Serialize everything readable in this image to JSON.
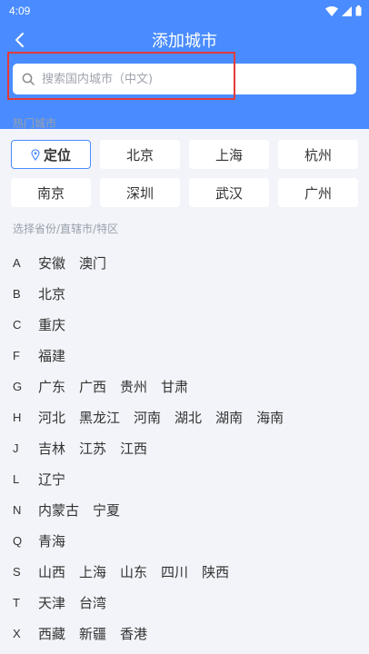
{
  "status": {
    "time": "4:09"
  },
  "header": {
    "title": "添加城市"
  },
  "search": {
    "placeholder": "搜索国内城市（中文)"
  },
  "hot": {
    "label": "热门城市",
    "locate_label": "定位",
    "cities": [
      "北京",
      "上海",
      "杭州",
      "南京",
      "深圳",
      "武汉",
      "广州"
    ]
  },
  "provinces_label": "选择省份/直辖市/特区",
  "provinces": [
    {
      "letter": "A",
      "items": [
        "安徽",
        "澳门"
      ]
    },
    {
      "letter": "B",
      "items": [
        "北京"
      ]
    },
    {
      "letter": "C",
      "items": [
        "重庆"
      ]
    },
    {
      "letter": "F",
      "items": [
        "福建"
      ]
    },
    {
      "letter": "G",
      "items": [
        "广东",
        "广西",
        "贵州",
        "甘肃"
      ]
    },
    {
      "letter": "H",
      "items": [
        "河北",
        "黑龙江",
        "河南",
        "湖北",
        "湖南",
        "海南"
      ]
    },
    {
      "letter": "J",
      "items": [
        "吉林",
        "江苏",
        "江西"
      ]
    },
    {
      "letter": "L",
      "items": [
        "辽宁"
      ]
    },
    {
      "letter": "N",
      "items": [
        "内蒙古",
        "宁夏"
      ]
    },
    {
      "letter": "Q",
      "items": [
        "青海"
      ]
    },
    {
      "letter": "S",
      "items": [
        "山西",
        "上海",
        "山东",
        "四川",
        "陕西"
      ]
    },
    {
      "letter": "T",
      "items": [
        "天津",
        "台湾"
      ]
    },
    {
      "letter": "X",
      "items": [
        "西藏",
        "新疆",
        "香港"
      ]
    }
  ],
  "colors": {
    "accent": "#4a8cff",
    "highlight": "#e53a3a",
    "background": "#f2f4f9"
  }
}
